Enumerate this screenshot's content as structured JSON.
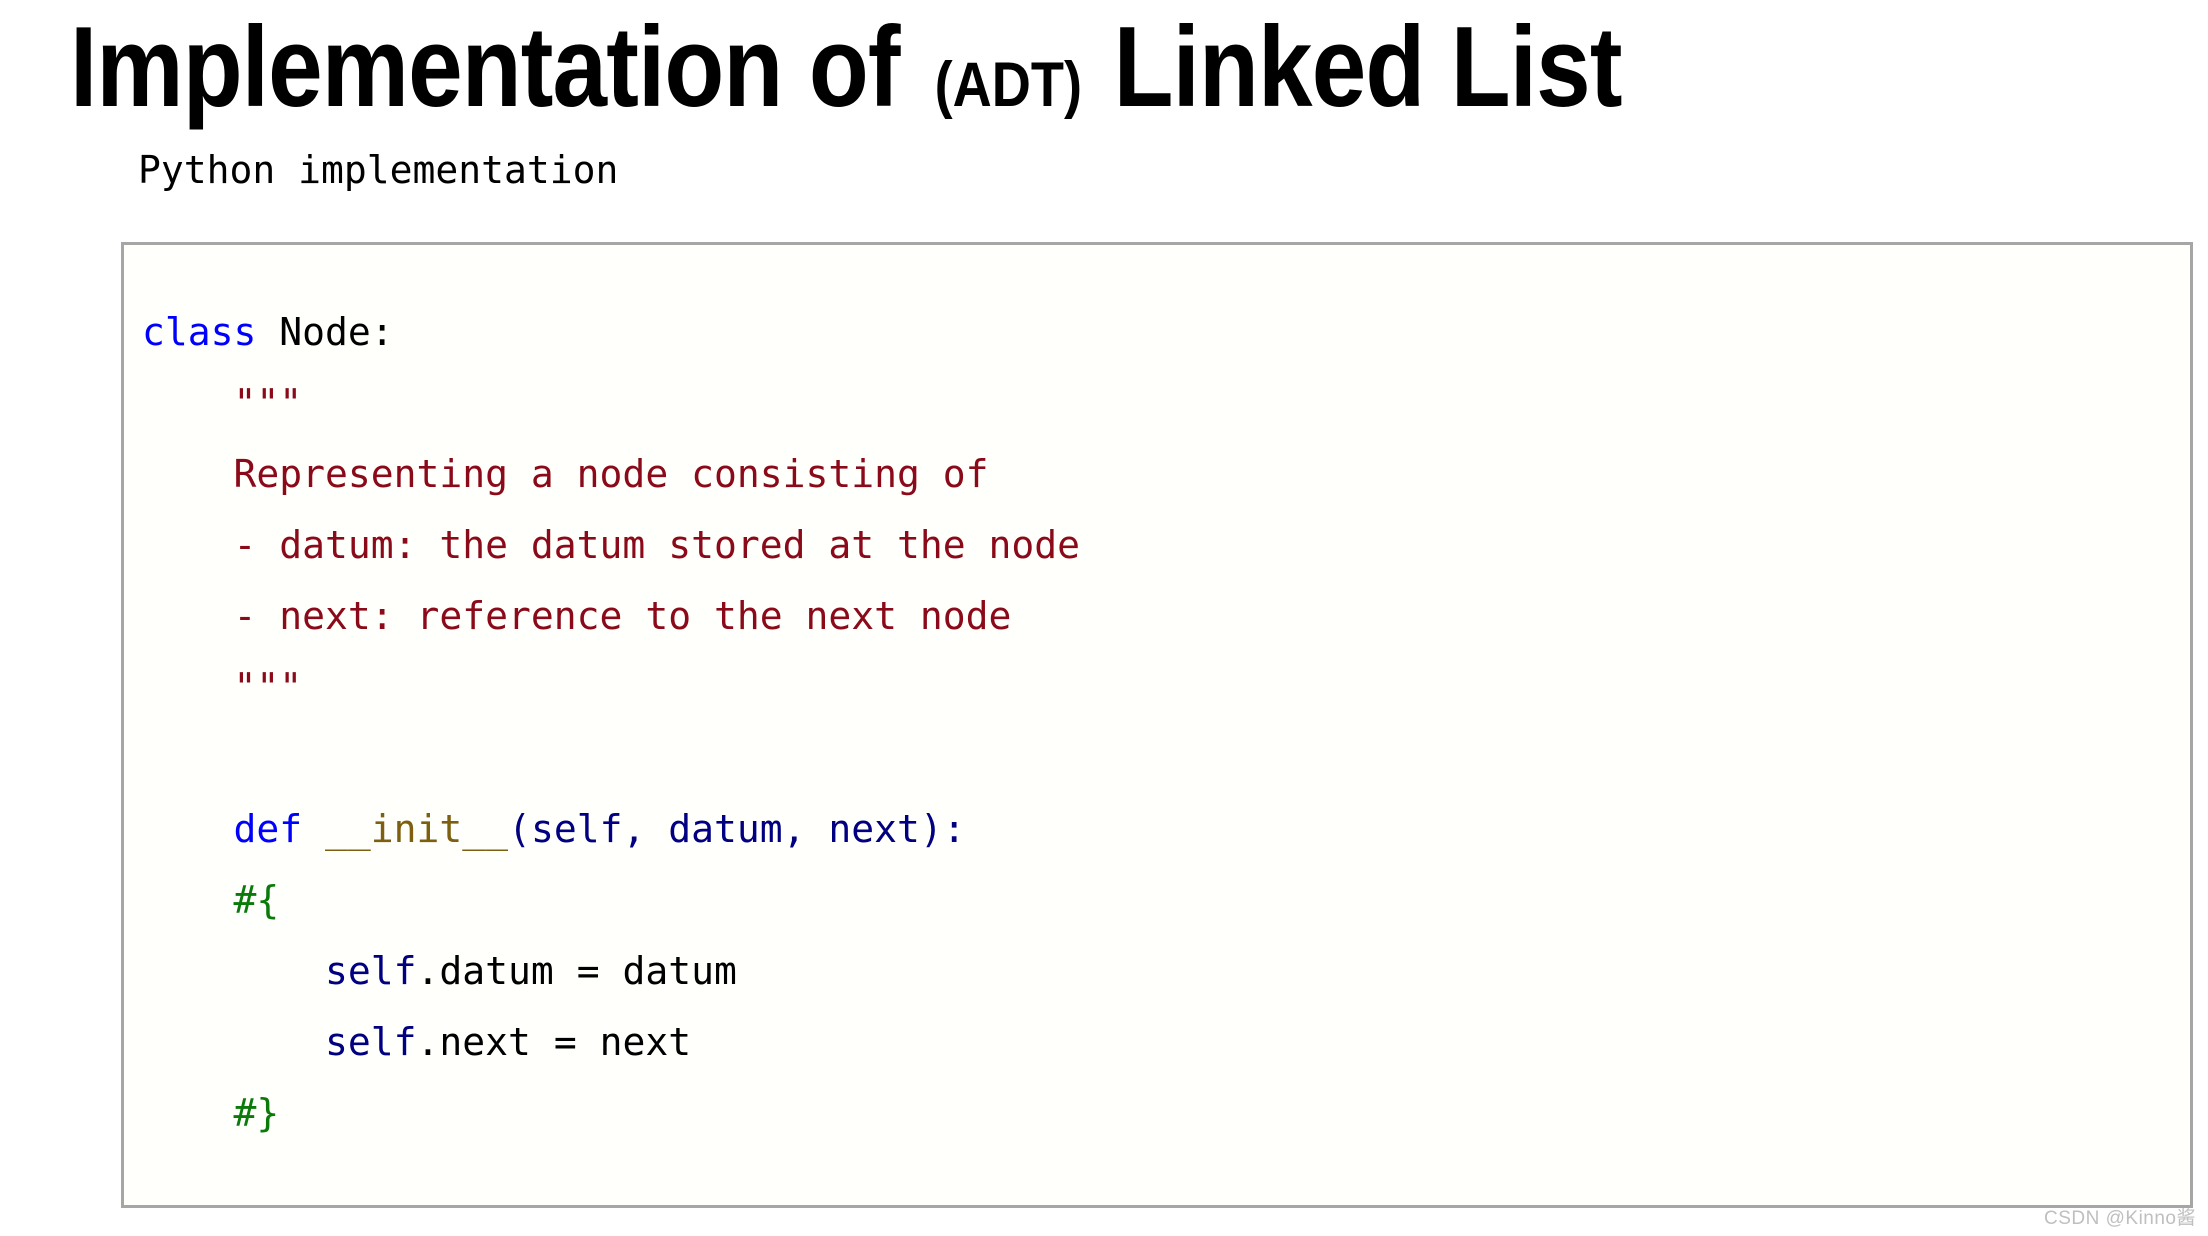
{
  "slide": {
    "title_main_1": "Implementation of ",
    "title_adt": "(ADT)",
    "title_main_2": " Linked List",
    "subtitle": "Python implementation"
  },
  "code": {
    "language": "python",
    "lines": [
      [
        {
          "text": "class ",
          "kind": "kw"
        },
        {
          "text": "Node:",
          "kind": "plain"
        }
      ],
      [
        {
          "text": "    \"\"\"",
          "kind": "doc"
        }
      ],
      [
        {
          "text": "    Representing a node consisting of",
          "kind": "doc"
        }
      ],
      [
        {
          "text": "    - datum: the datum stored at the node",
          "kind": "doc"
        }
      ],
      [
        {
          "text": "    - next: reference to the next node",
          "kind": "doc"
        }
      ],
      [
        {
          "text": "    \"\"\"",
          "kind": "doc"
        }
      ],
      [
        {
          "text": "",
          "kind": "plain"
        }
      ],
      [
        {
          "text": "    def ",
          "kind": "kw"
        },
        {
          "text": "__init__",
          "kind": "fn"
        },
        {
          "text": "(self, datum, next):",
          "kind": "param"
        }
      ],
      [
        {
          "text": "    #{",
          "kind": "comment"
        }
      ],
      [
        {
          "text": "        ",
          "kind": "plain"
        },
        {
          "text": "self",
          "kind": "self"
        },
        {
          "text": ".datum = datum",
          "kind": "plain"
        }
      ],
      [
        {
          "text": "        ",
          "kind": "plain"
        },
        {
          "text": "self",
          "kind": "self"
        },
        {
          "text": ".next = next",
          "kind": "plain"
        }
      ],
      [
        {
          "text": "    #}",
          "kind": "comment"
        }
      ]
    ]
  },
  "watermark": {
    "text": "CSDN @Kinno酱"
  },
  "colors": {
    "keyword": "#0000ff",
    "docstring": "#8b0a1a",
    "function": "#7d5f10",
    "parameter": "#000080",
    "comment": "#0a7a0a",
    "plain": "#000000",
    "box_border": "#a6a6a6",
    "box_background": "#fffffb",
    "watermark": "#bfbfbf"
  }
}
